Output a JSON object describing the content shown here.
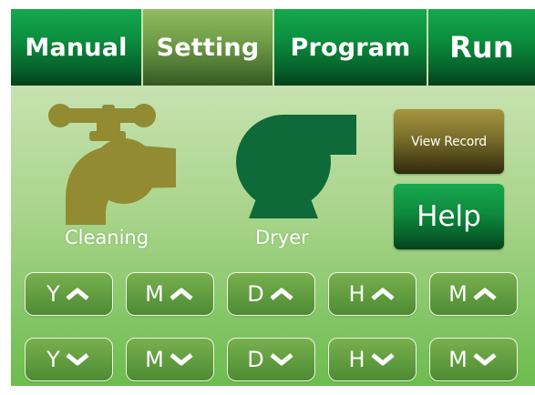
{
  "tabs": [
    {
      "label": "Manual",
      "active": false
    },
    {
      "label": "Setting",
      "active": true
    },
    {
      "label": "Program",
      "active": false
    },
    {
      "label": "Run",
      "active": false
    }
  ],
  "devices": {
    "cleaning": {
      "label": "Cleaning",
      "icon": "faucet-icon",
      "color": "#928b32"
    },
    "dryer": {
      "label": "Dryer",
      "icon": "blower-icon",
      "color": "#0f6a3a"
    }
  },
  "side_buttons": {
    "view_record": "View Record",
    "help": "Help"
  },
  "adjust": {
    "up": [
      {
        "letter": "Y",
        "icon": "chevron-up-icon"
      },
      {
        "letter": "M",
        "icon": "chevron-up-icon"
      },
      {
        "letter": "D",
        "icon": "chevron-up-icon"
      },
      {
        "letter": "H",
        "icon": "chevron-up-icon"
      },
      {
        "letter": "M",
        "icon": "chevron-up-icon"
      }
    ],
    "down": [
      {
        "letter": "Y",
        "icon": "chevron-down-icon"
      },
      {
        "letter": "M",
        "icon": "chevron-down-icon"
      },
      {
        "letter": "D",
        "icon": "chevron-down-icon"
      },
      {
        "letter": "H",
        "icon": "chevron-down-icon"
      },
      {
        "letter": "M",
        "icon": "chevron-down-icon"
      }
    ]
  }
}
